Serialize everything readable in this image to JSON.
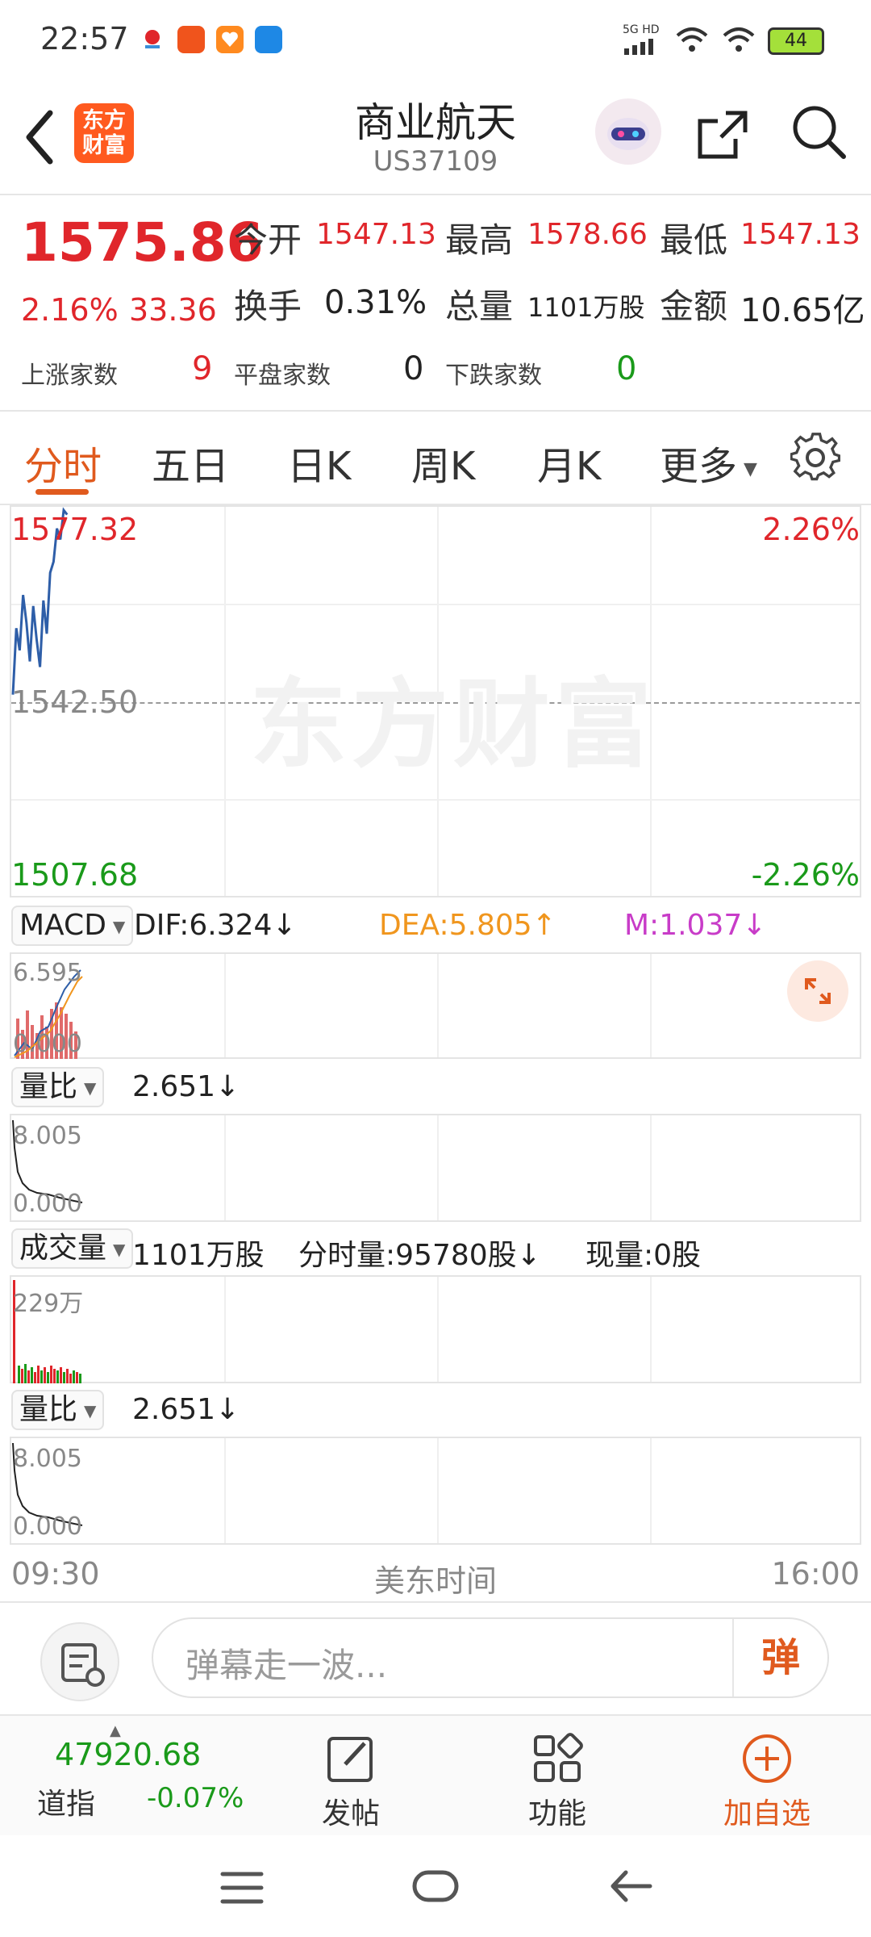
{
  "status_bar": {
    "time": "22:57",
    "network": "5G HD",
    "battery": "44"
  },
  "header": {
    "back_icon": "chevron-left-icon",
    "logo_text_line1": "东方",
    "logo_text_line2": "财富",
    "title": "商业航天",
    "code": "US37109",
    "share_icon": "share-icon",
    "search_icon": "search-icon"
  },
  "quote": {
    "price": "1575.86",
    "change_pct": "2.16%",
    "change_abs": "33.36",
    "open_label": "今开",
    "open": "1547.13",
    "high_label": "最高",
    "high": "1578.66",
    "low_label": "最低",
    "low": "1547.13",
    "turnover_label": "换手",
    "turnover": "0.31%",
    "volume_label": "总量",
    "volume": "1101万股",
    "amount_label": "金额",
    "amount": "10.65亿",
    "up_label": "上涨家数",
    "up_count": "9",
    "flat_label": "平盘家数",
    "flat_count": "0",
    "down_label": "下跌家数",
    "down_count": "0"
  },
  "tabs": {
    "items": [
      "分时",
      "五日",
      "日K",
      "周K",
      "月K",
      "更多"
    ],
    "active": 0,
    "settings_icon": "gear-icon"
  },
  "main_chart": {
    "y_top": "1577.32",
    "y_mid": "1542.50",
    "y_bottom": "1507.68",
    "pct_top": "2.26%",
    "pct_bottom": "-2.26%",
    "watermark": "东方财富"
  },
  "macd": {
    "selector": "MACD",
    "dif": "DIF:6.324↓",
    "dea": "DEA:5.805↑",
    "m": "M:1.037↓",
    "y_top": "6.595",
    "y_bottom": "0.000"
  },
  "ratio1": {
    "selector": "量比",
    "value": "2.651↓",
    "y_top": "8.005",
    "y_bottom": "0.000"
  },
  "volume": {
    "selector": "成交量",
    "total": "1101万股",
    "minute_vol": "分时量:95780股↓",
    "current_vol": "现量:0股",
    "y_top": "229万"
  },
  "ratio2": {
    "selector": "量比",
    "value": "2.651↓",
    "y_top": "8.005",
    "y_bottom": "0.000"
  },
  "time_axis": {
    "start": "09:30",
    "label": "美东时间",
    "end": "16:00"
  },
  "comment": {
    "placeholder": "弹幕走一波...",
    "danmu_label": "弹"
  },
  "toolbar": {
    "index_value": "47920.68",
    "index_name": "道指",
    "index_change": "-0.07%",
    "post_label": "发帖",
    "functions_label": "功能",
    "add_watch_label": "加自选"
  },
  "chart_data": {
    "type": "line",
    "title": "",
    "series": [
      {
        "values": [
          1544.0,
          1556.0,
          1552.0,
          1562.0,
          1557.0,
          1550.0,
          1560.0,
          1554.0,
          1549.0,
          1561.0,
          1555.0,
          1566.0,
          1568.0,
          1574.0,
          1572.0,
          1577.3,
          1576.5
        ]
      }
    ],
    "ylim": [
      1507.68,
      1577.32
    ],
    "reference": 1542.5,
    "xlabel_start": "09:30",
    "xlabel_end": "16:00",
    "grid": true
  }
}
